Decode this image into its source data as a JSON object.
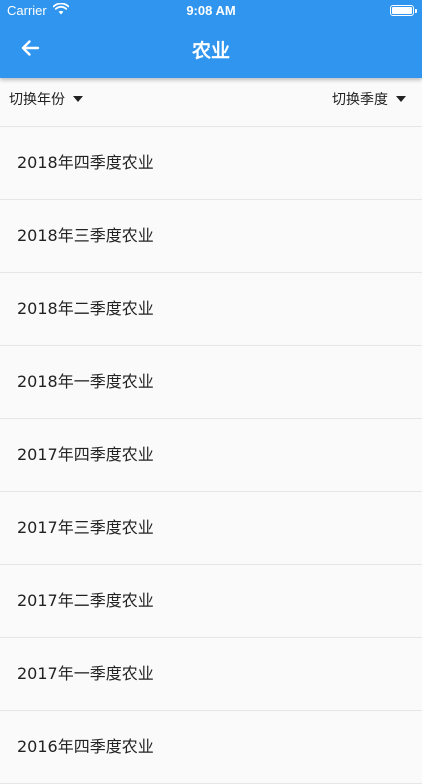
{
  "status_bar": {
    "carrier": "Carrier",
    "time": "9:08 AM"
  },
  "app_bar": {
    "title": "农业",
    "back_icon": "arrow-left-icon"
  },
  "filters": {
    "year_label": "切换年份",
    "quarter_label": "切换季度"
  },
  "list": {
    "items": [
      {
        "label": "2018年四季度农业"
      },
      {
        "label": "2018年三季度农业"
      },
      {
        "label": "2018年二季度农业"
      },
      {
        "label": "2018年一季度农业"
      },
      {
        "label": "2017年四季度农业"
      },
      {
        "label": "2017年三季度农业"
      },
      {
        "label": "2017年二季度农业"
      },
      {
        "label": "2017年一季度农业"
      },
      {
        "label": "2016年四季度农业"
      }
    ]
  },
  "colors": {
    "primary": "#2f95ee",
    "background": "#fafafa",
    "divider": "#e6e6e6"
  }
}
